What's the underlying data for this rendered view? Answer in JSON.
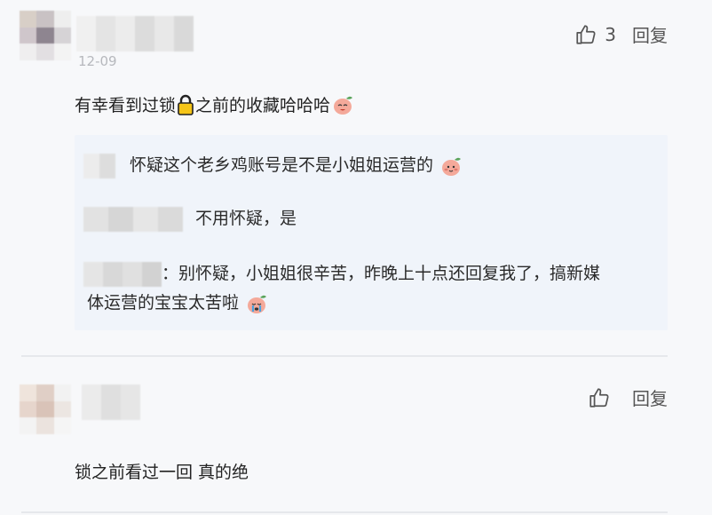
{
  "comments": [
    {
      "timestamp": "12-09",
      "like_count": "3",
      "reply_label": "回复",
      "text_before_lock": "有幸看到过锁",
      "lock_icon": "lock-emoji",
      "text_after_lock": "之前的收藏哈哈哈",
      "trailing_emoji": "peach-laughing-emoji",
      "replies": [
        {
          "text": "怀疑这个老乡鸡账号是不是小姐姐运营的",
          "emoji": "peach-shy-emoji"
        },
        {
          "text": "不用怀疑，是"
        },
        {
          "text_line1": "：别怀疑，小姐姐很辛苦，昨晚上十点还回复我了，搞新媒",
          "text_line2": "体运营的宝宝太苦啦",
          "emoji": "peach-crying-emoji"
        }
      ]
    },
    {
      "reply_label": "回复",
      "text": "锁之前看过一回 真的绝"
    }
  ],
  "colors": {
    "background": "#f7f8fa",
    "reply_box": "#f0f4fa",
    "divider": "#e6e8ec",
    "timestamp": "#b6b8bd"
  }
}
